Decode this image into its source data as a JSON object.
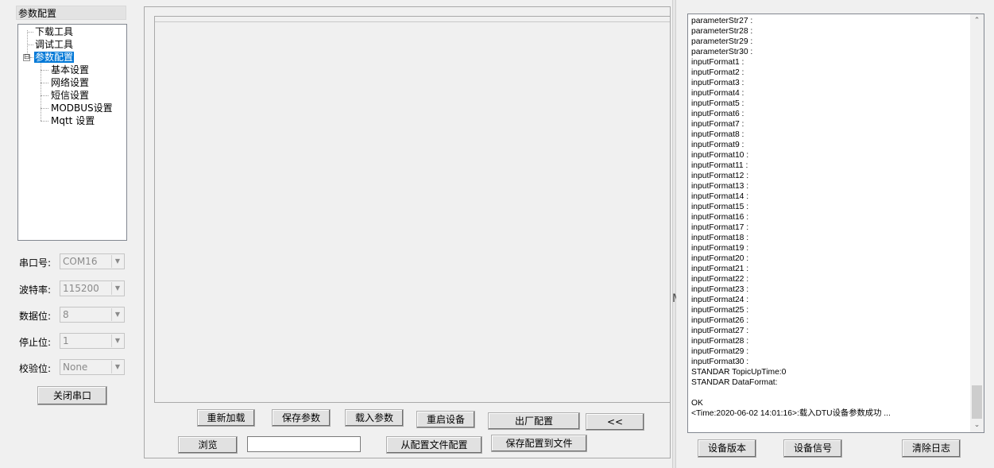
{
  "left": {
    "title": "参数配置",
    "tree": {
      "items": [
        {
          "label": "下载工具"
        },
        {
          "label": "调试工具"
        },
        {
          "label": "参数配置",
          "expander": "⊟"
        },
        {
          "label": "基本设置"
        },
        {
          "label": "网络设置"
        },
        {
          "label": "短信设置"
        },
        {
          "label": "MODBUS设置"
        },
        {
          "label": "Mqtt 设置"
        }
      ]
    },
    "fields": [
      {
        "label": "串口号:",
        "value": "COM16"
      },
      {
        "label": "波特率:",
        "value": "115200"
      },
      {
        "label": "数据位:",
        "value": "8"
      },
      {
        "label": "停止位:",
        "value": "1"
      },
      {
        "label": "校验位:",
        "value": "None"
      }
    ],
    "close_port_label": "关闭串口",
    "dropdown_arrow": "▼"
  },
  "center": {
    "buttons_row1": {
      "reload": "重新加载",
      "save_params": "保存参数",
      "load_params": "载入参数",
      "restart": "重启设备",
      "factory": "出厂配置",
      "collapse": "<<"
    },
    "buttons_row2": {
      "browse": "浏览",
      "path_value": "",
      "from_file": "从配置文件配置",
      "save_to_file": "保存配置到文件"
    }
  },
  "right": {
    "log_lines": [
      "parameterStr27 :",
      "parameterStr28 :",
      "parameterStr29 :",
      "parameterStr30 :",
      "inputFormat1 :",
      "inputFormat2 :",
      "inputFormat3 :",
      "inputFormat4 :",
      "inputFormat5 :",
      "inputFormat6 :",
      "inputFormat7 :",
      "inputFormat8 :",
      "inputFormat9 :",
      "inputFormat10 :",
      "inputFormat11 :",
      "inputFormat12 :",
      "inputFormat13 :",
      "inputFormat14 :",
      "inputFormat15 :",
      "inputFormat16 :",
      "inputFormat17 :",
      "inputFormat18 :",
      "inputFormat19 :",
      "inputFormat20 :",
      "inputFormat21 :",
      "inputFormat22 :",
      "inputFormat23 :",
      "inputFormat24 :",
      "inputFormat25 :",
      "inputFormat26 :",
      "inputFormat27 :",
      "inputFormat28 :",
      "inputFormat29 :",
      "inputFormat30 :",
      "STANDAR TopicUpTime:0",
      "STANDAR DataFormat:",
      "",
      "OK",
      "<Time:2020-06-02 14:01:16>:载入DTU设备参数成功 ..."
    ],
    "scroll_up": "⌃",
    "scroll_down": "⌄",
    "buttons": {
      "device_version": "设备版本",
      "device_signal": "设备信号",
      "clear_log": "清除日志"
    }
  },
  "divider_glyph": "M"
}
